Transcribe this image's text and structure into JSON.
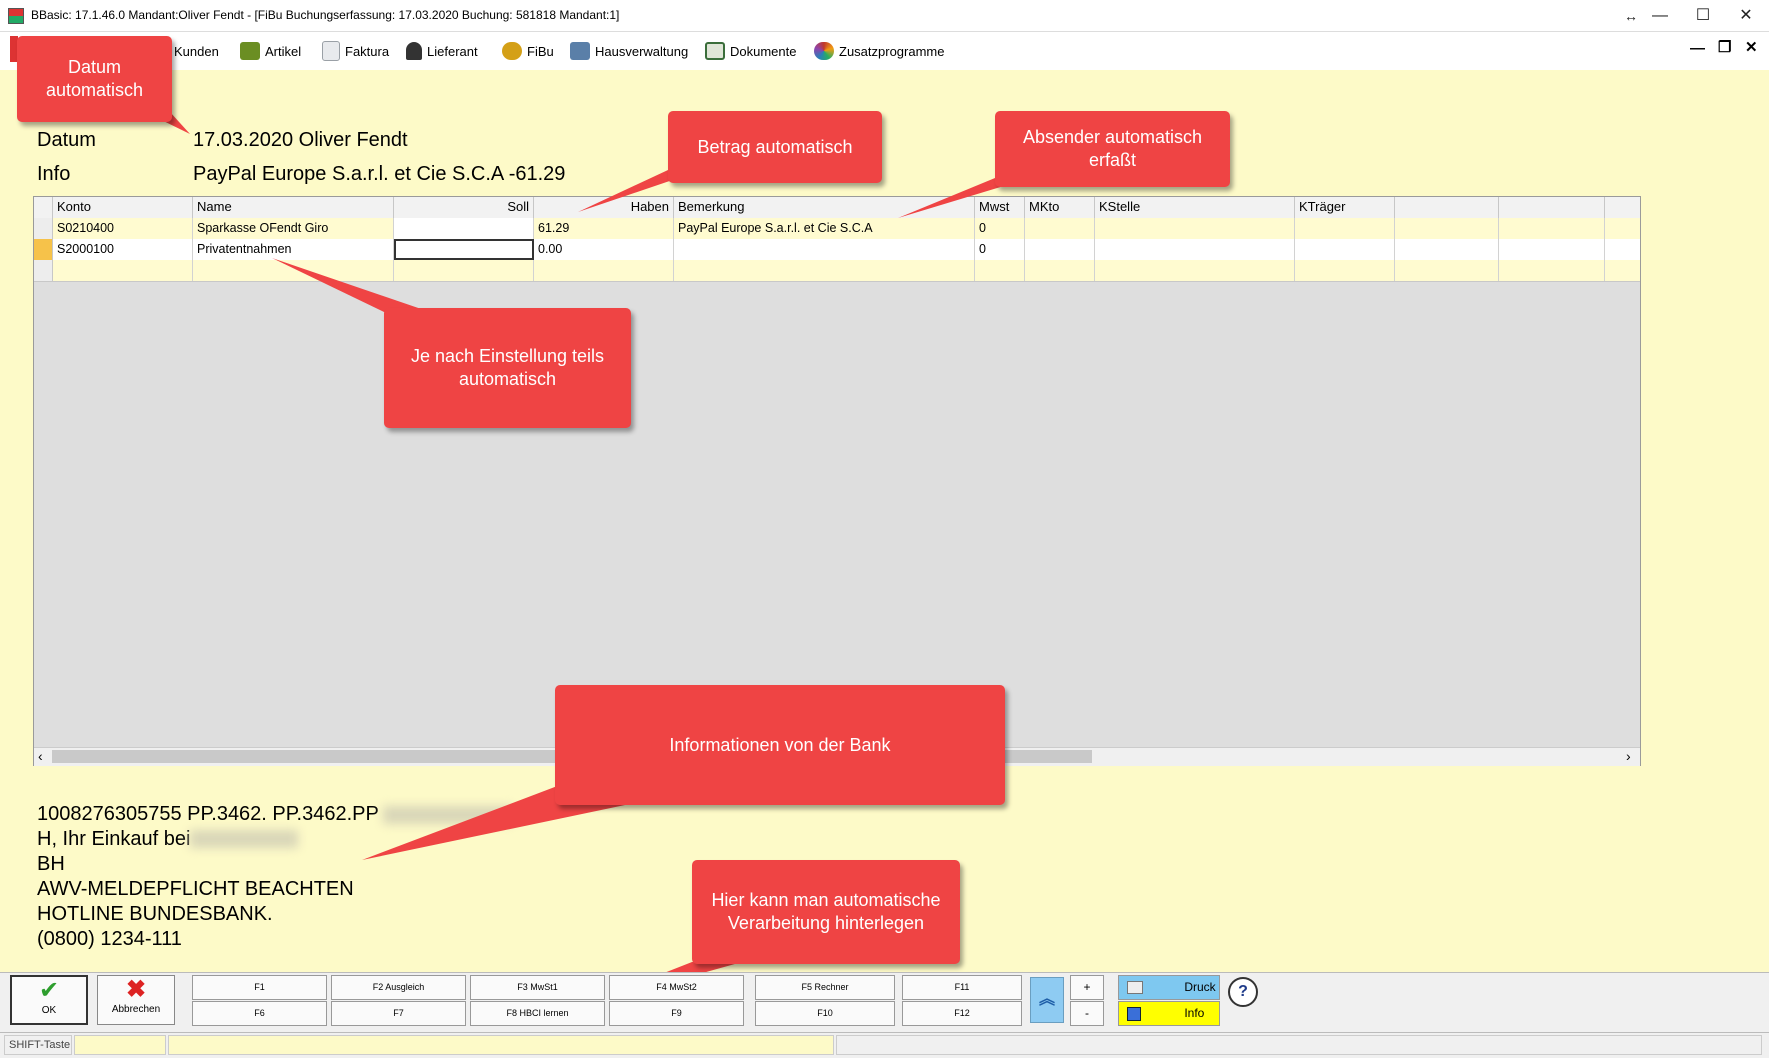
{
  "window": {
    "title": "BBasic: 17.1.46.0 Mandant:Oliver Fendt  - [FiBu Buchungserfassung: 17.03.2020  Buchung: 581818  Mandant:1]",
    "resize_glyph": "↔",
    "minimize": "—",
    "maximize": "☐",
    "close": "✕"
  },
  "toolbar": {
    "items": [
      {
        "label": "Kunden",
        "icon": "customers-icon",
        "color": "#4a7fc1"
      },
      {
        "label": "Artikel",
        "icon": "article-icon",
        "color": "#6b8e23"
      },
      {
        "label": "Faktura",
        "icon": "invoice-icon",
        "color": "#9aa0a6"
      },
      {
        "label": "Lieferant",
        "icon": "supplier-icon",
        "color": "#333333"
      },
      {
        "label": "FiBu",
        "icon": "accounting-icon",
        "color": "#d4a017"
      },
      {
        "label": "Hausverwaltung",
        "icon": "property-icon",
        "color": "#5a7fa8"
      },
      {
        "label": "Dokumente",
        "icon": "documents-icon",
        "color": "#3b6e3b"
      },
      {
        "label": "Zusatzprogramme",
        "icon": "addons-icon",
        "color": "#c0392b"
      }
    ],
    "mdi_minimize": "—",
    "mdi_restore": "❐",
    "mdi_close": "✕"
  },
  "header": {
    "datum_label": "Datum",
    "datum_value": "17.03.2020  Oliver Fendt",
    "info_label": "Info",
    "info_value": "PayPal Europe S.a.r.l. et Cie S.C.A -61.29"
  },
  "grid": {
    "columns": [
      "Konto",
      "Name",
      "Soll",
      "Haben",
      "Bemerkung",
      "Mwst",
      "MKto",
      "KStelle",
      "KTräger",
      "",
      ""
    ],
    "rows": [
      {
        "konto": "S0210400",
        "name": "Sparkasse OFendt Giro",
        "soll": "",
        "haben": "61.29",
        "bemerkung": "PayPal Europe S.a.r.l. et Cie S.C.A",
        "mwst": "0"
      },
      {
        "konto": "S2000100",
        "name": "Privatentnahmen",
        "soll": "",
        "haben": "0.00",
        "bemerkung": "",
        "mwst": "0"
      }
    ],
    "scroll_left": "‹",
    "scroll_right": "›"
  },
  "bank_info": {
    "lines": [
      "1008276305755 PP.3462. PP.3462.PP",
      "H, Ihr Einkauf bei",
      "BH",
      "AWV-MELDEPFLICHT BEACHTEN",
      "HOTLINE BUNDESBANK.",
      "(0800) 1234-111"
    ]
  },
  "callouts": {
    "datum": "Datum\nautomatisch",
    "betrag": "Betrag automatisch",
    "absender": "Absender automatisch\nerfaßt",
    "einstellung": "Je nach Einstellung teils\nautomatisch",
    "bank": "Informationen von der Bank",
    "verarbeitung": "Hier kann man automatische\nVerarbeitung hinterlegen"
  },
  "buttons": {
    "ok": "OK",
    "abbrechen": "Abbrechen",
    "fkeys_top": [
      "F1",
      "F2 Ausgleich",
      "F3 MwSt1",
      "F4 MwSt2",
      "F5 Rechner",
      "F11"
    ],
    "fkeys_bottom": [
      "F6",
      "F7",
      "F8 HBCI lernen",
      "F9",
      "F10",
      "F12"
    ],
    "plus": "+",
    "minus": "-",
    "druck": "Druck",
    "info": "Info",
    "help": "?"
  },
  "status": {
    "shift": "SHIFT-Taste"
  },
  "colors": {
    "background": "#fdfac8",
    "callout": "#ef4444",
    "info_button": "#ffff00",
    "druck_button": "#7ec8f0"
  }
}
